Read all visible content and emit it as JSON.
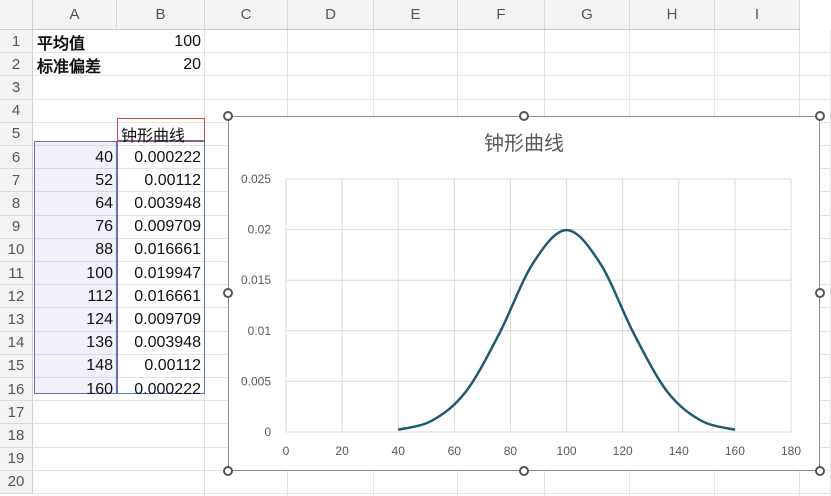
{
  "columns": [
    "A",
    "B",
    "C",
    "D",
    "E",
    "F",
    "G",
    "H",
    "I"
  ],
  "rows": [
    "1",
    "2",
    "3",
    "4",
    "5",
    "6",
    "7",
    "8",
    "9",
    "10",
    "11",
    "12",
    "13",
    "14",
    "15",
    "16",
    "17",
    "18",
    "19",
    "20"
  ],
  "cells": {
    "a1": "平均值",
    "b1": "100",
    "a2": "标准偏差",
    "b2": "20",
    "b5": "钟形曲线",
    "x": [
      "40",
      "52",
      "64",
      "76",
      "88",
      "100",
      "112",
      "124",
      "136",
      "148",
      "160"
    ],
    "y": [
      "0.000222",
      "0.00112",
      "0.003948",
      "0.009709",
      "0.016661",
      "0.019947",
      "0.016661",
      "0.009709",
      "0.003948",
      "0.00112",
      "0.000222"
    ]
  },
  "chart_data": {
    "type": "scatter",
    "title": "钟形曲线",
    "line_color": "#1f5a72",
    "smooth": true,
    "x": [
      40,
      52,
      64,
      76,
      88,
      100,
      112,
      124,
      136,
      148,
      160
    ],
    "y": [
      0.000222,
      0.00112,
      0.003948,
      0.009709,
      0.016661,
      0.019947,
      0.016661,
      0.009709,
      0.003948,
      0.00112,
      0.000222
    ],
    "xlim": [
      0,
      180
    ],
    "ylim": [
      0,
      0.025
    ],
    "xticks": [
      "0",
      "20",
      "40",
      "60",
      "80",
      "100",
      "120",
      "140",
      "160",
      "180"
    ],
    "yticks": [
      "0",
      "0.005",
      "0.01",
      "0.015",
      "0.02",
      "0.025"
    ],
    "grid": true
  }
}
